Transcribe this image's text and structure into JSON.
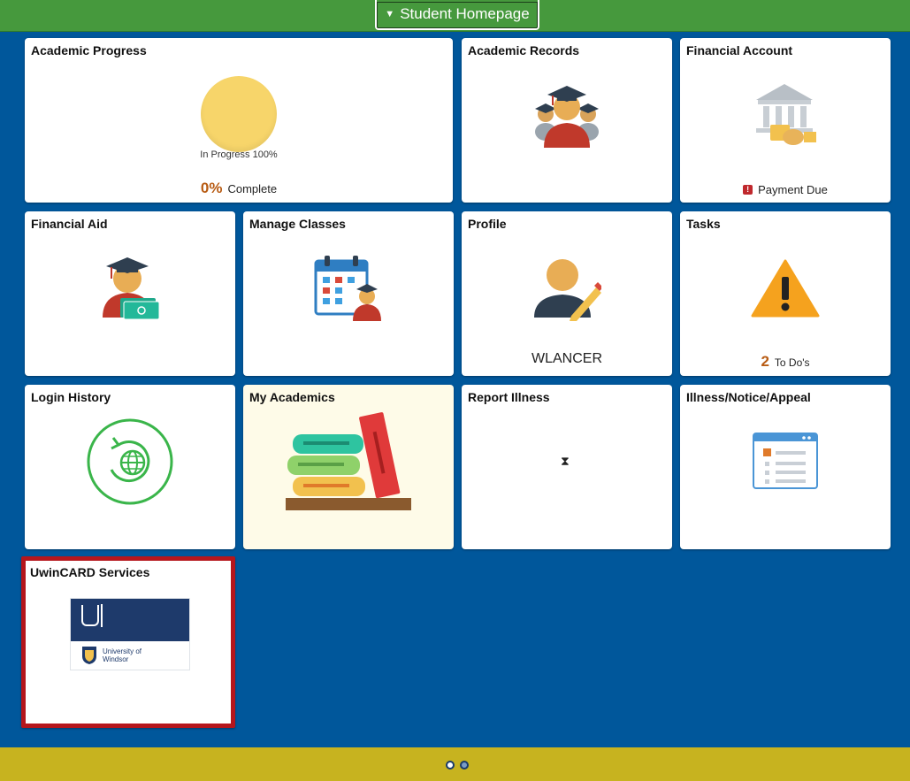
{
  "header": {
    "title": "Student Homepage"
  },
  "tiles": {
    "academic_progress": {
      "title": "Academic Progress",
      "in_progress": "In Progress 100%",
      "percent": "0%",
      "complete": "Complete"
    },
    "academic_records": {
      "title": "Academic Records"
    },
    "financial_account": {
      "title": "Financial Account",
      "status": "Payment Due"
    },
    "financial_aid": {
      "title": "Financial Aid"
    },
    "manage_classes": {
      "title": "Manage Classes"
    },
    "profile": {
      "title": "Profile",
      "username": "WLANCER"
    },
    "tasks": {
      "title": "Tasks",
      "count": "2",
      "label": "To Do's"
    },
    "login_history": {
      "title": "Login History"
    },
    "my_academics": {
      "title": "My Academics"
    },
    "report_illness": {
      "title": "Report Illness"
    },
    "illness_notice": {
      "title": "Illness/Notice/Appeal"
    },
    "uwincard": {
      "title": "UwinCARD Services",
      "logo_text": "University of Windsor"
    }
  },
  "pager": {
    "pages": 2,
    "current": 1
  },
  "colors": {
    "header_green": "#46993d",
    "background_blue": "#00579b",
    "footer_gold": "#c7b31f",
    "accent_orange": "#b85c14",
    "selection_red": "#b5161c"
  }
}
